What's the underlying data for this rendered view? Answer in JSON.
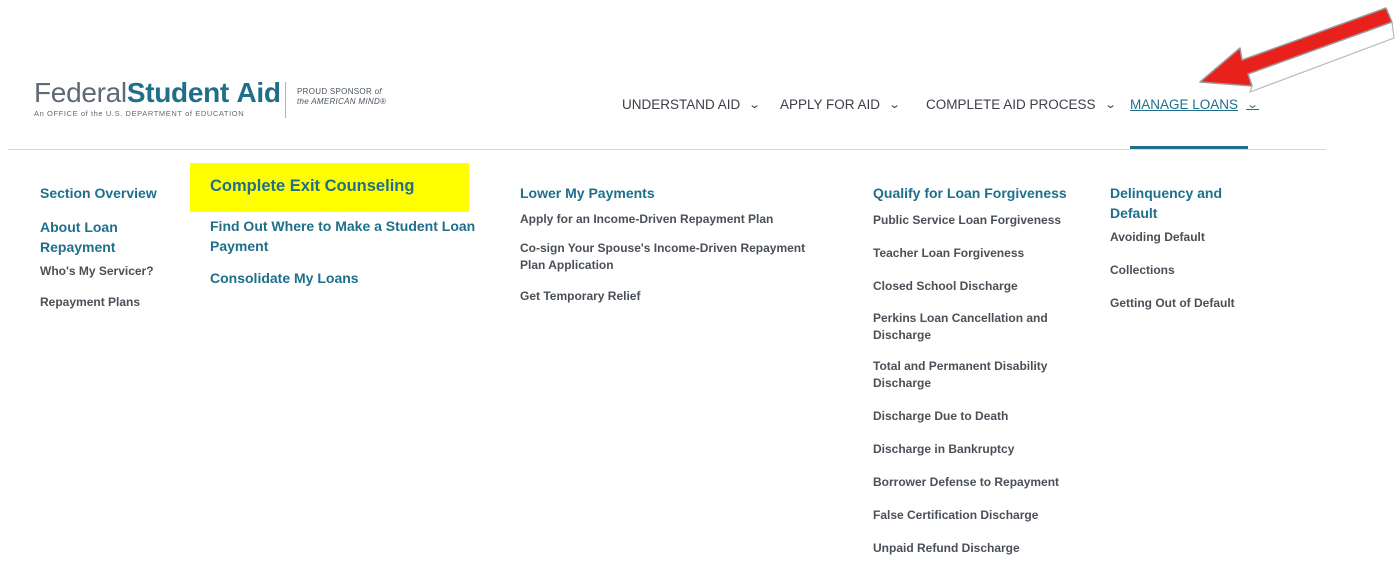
{
  "logo": {
    "part1": "Federal",
    "part2": "Student",
    "part3": "Aid",
    "tagline": "An OFFICE of the U.S. DEPARTMENT of EDUCATION",
    "sponsor_line1": "PROUD SPONSOR",
    "sponsor_of": "of",
    "sponsor_line2": "the AMERICAN MIND®"
  },
  "nav": {
    "understand": "UNDERSTAND AID",
    "apply": "APPLY FOR AID",
    "complete": "COMPLETE AID PROCESS",
    "manage": "MANAGE LOANS",
    "active_item": "MANAGE LOANS"
  },
  "menu": {
    "col1": {
      "section_overview": "Section Overview",
      "about_line1": "About Loan",
      "about_line2": "Repayment",
      "servicer": "Who's My Servicer?",
      "plans": "Repayment Plans"
    },
    "col2": {
      "exit_counseling": "Complete Exit Counseling",
      "payment_line1": "Find Out Where to Make a Student Loan",
      "payment_line2": "Payment",
      "consolidate": "Consolidate My Loans"
    },
    "col3": {
      "lower": "Lower My Payments",
      "idr": "Apply for an Income-Driven Repayment Plan",
      "cosign_line1": "Co-sign Your Spouse's Income-Driven Repayment",
      "cosign_line2": "Plan Application",
      "relief": "Get Temporary Relief"
    },
    "col4": {
      "qualify": "Qualify for Loan Forgiveness",
      "pslf": "Public Service Loan Forgiveness",
      "teacher": "Teacher Loan Forgiveness",
      "closed": "Closed School Discharge",
      "perkins_line1": "Perkins Loan Cancellation and",
      "perkins_line2": "Discharge",
      "tpd_line1": "Total and Permanent Disability",
      "tpd_line2": "Discharge",
      "death": "Discharge Due to Death",
      "bankruptcy": "Discharge in Bankruptcy",
      "borrower": "Borrower Defense to Repayment",
      "false_cert": "False Certification Discharge",
      "unpaid": "Unpaid Refund Discharge"
    },
    "col5": {
      "delinquency_line1": "Delinquency and",
      "delinquency_line2": "Default",
      "avoiding": "Avoiding Default",
      "collections": "Collections",
      "getting_out": "Getting Out of Default"
    }
  },
  "colors": {
    "brand_blue": "#1f6f8b",
    "highlight": "#ffff00",
    "annotation_arrow": "#e8211c"
  },
  "icons": {
    "nav_chevron": "chevron-down-icon",
    "annotation": "red-arrow-icon"
  }
}
